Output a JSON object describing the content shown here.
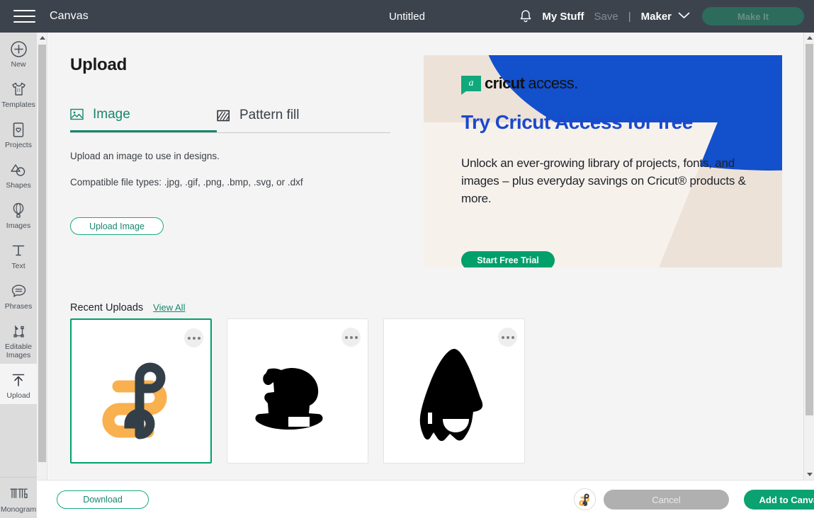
{
  "topbar": {
    "menu_icon": "hamburger-icon",
    "canvas_label": "Canvas",
    "project_title": "Untitled",
    "bell_icon": "notification-bell-icon",
    "my_stuff_label": "My Stuff",
    "save_label": "Save",
    "divider": "|",
    "machine_label": "Maker",
    "chevron_icon": "chevron-down-icon",
    "make_it_label": "Make It",
    "bg_color": "#3d434d",
    "make_it_color": "#2d6b5c"
  },
  "sidebar": {
    "items": [
      {
        "label": "New",
        "icon": "plus-circle-icon",
        "active": false
      },
      {
        "label": "Templates",
        "icon": "tshirt-icon",
        "active": false
      },
      {
        "label": "Projects",
        "icon": "card-heart-icon",
        "active": false
      },
      {
        "label": "Shapes",
        "icon": "shapes-icon",
        "active": false
      },
      {
        "label": "Images",
        "icon": "hot-air-balloon-icon",
        "active": false
      },
      {
        "label": "Text",
        "icon": "text-t-icon",
        "active": false
      },
      {
        "label": "Phrases",
        "icon": "speech-bubble-icon",
        "active": false
      },
      {
        "label": "Editable Images",
        "icon": "editable-nodes-icon",
        "active": false
      },
      {
        "label": "Upload",
        "icon": "upload-arrow-icon",
        "active": true
      }
    ],
    "bottom_item": {
      "label": "Monogram",
      "icon": "monogram-icon"
    },
    "bg_color": "#dcdcdc"
  },
  "main": {
    "heading": "Upload",
    "tabs": [
      {
        "label": "Image",
        "icon": "picture-icon",
        "active": true
      },
      {
        "label": "Pattern fill",
        "icon": "pattern-swatch-icon",
        "active": false
      }
    ],
    "description": "Upload an image to use in designs.",
    "file_types": "Compatible file types: .jpg, .gif, .png, .bmp, .svg, or .dxf",
    "upload_button": "Upload Image",
    "accent_color": "#17876e"
  },
  "promo": {
    "brand_mark": "a",
    "brand_bold": "cricut",
    "brand_light": "access.",
    "heading": "Try Cricut Access for free",
    "body": "Unlock an ever-growing library of projects, fonts, and images – plus everyday savings on Cricut® products & more.",
    "cta_label": "Start Free Trial",
    "bg_color": "#ede2d8",
    "blue_color": "#1250cc",
    "heading_color": "#1a49cc",
    "cta_color": "#00a06b"
  },
  "recent": {
    "title": "Recent Uploads",
    "view_all": "View All",
    "cards": [
      {
        "art": "infinity-knot-orange-dark",
        "selected": true,
        "menu_icon": "more-options-icon"
      },
      {
        "art": "rocking-horse-silhouette",
        "selected": false,
        "menu_icon": "more-options-icon"
      },
      {
        "art": "gnome-silhouette",
        "selected": false,
        "menu_icon": "more-options-icon"
      }
    ]
  },
  "bottombar": {
    "download_label": "Download",
    "avatar_icon": "selected-image-thumbnail",
    "cancel_label": "Cancel",
    "add_to_canvas_label": "Add to Canvas",
    "cancel_color": "#b0b0b0",
    "add_color": "#0ba271"
  },
  "scrollbars": {
    "left_up_icon": "scroll-up-arrow-icon",
    "left_down_icon": "scroll-down-arrow-icon",
    "right_up_icon": "scroll-up-arrow-icon",
    "right_down_icon": "scroll-down-arrow-icon"
  }
}
